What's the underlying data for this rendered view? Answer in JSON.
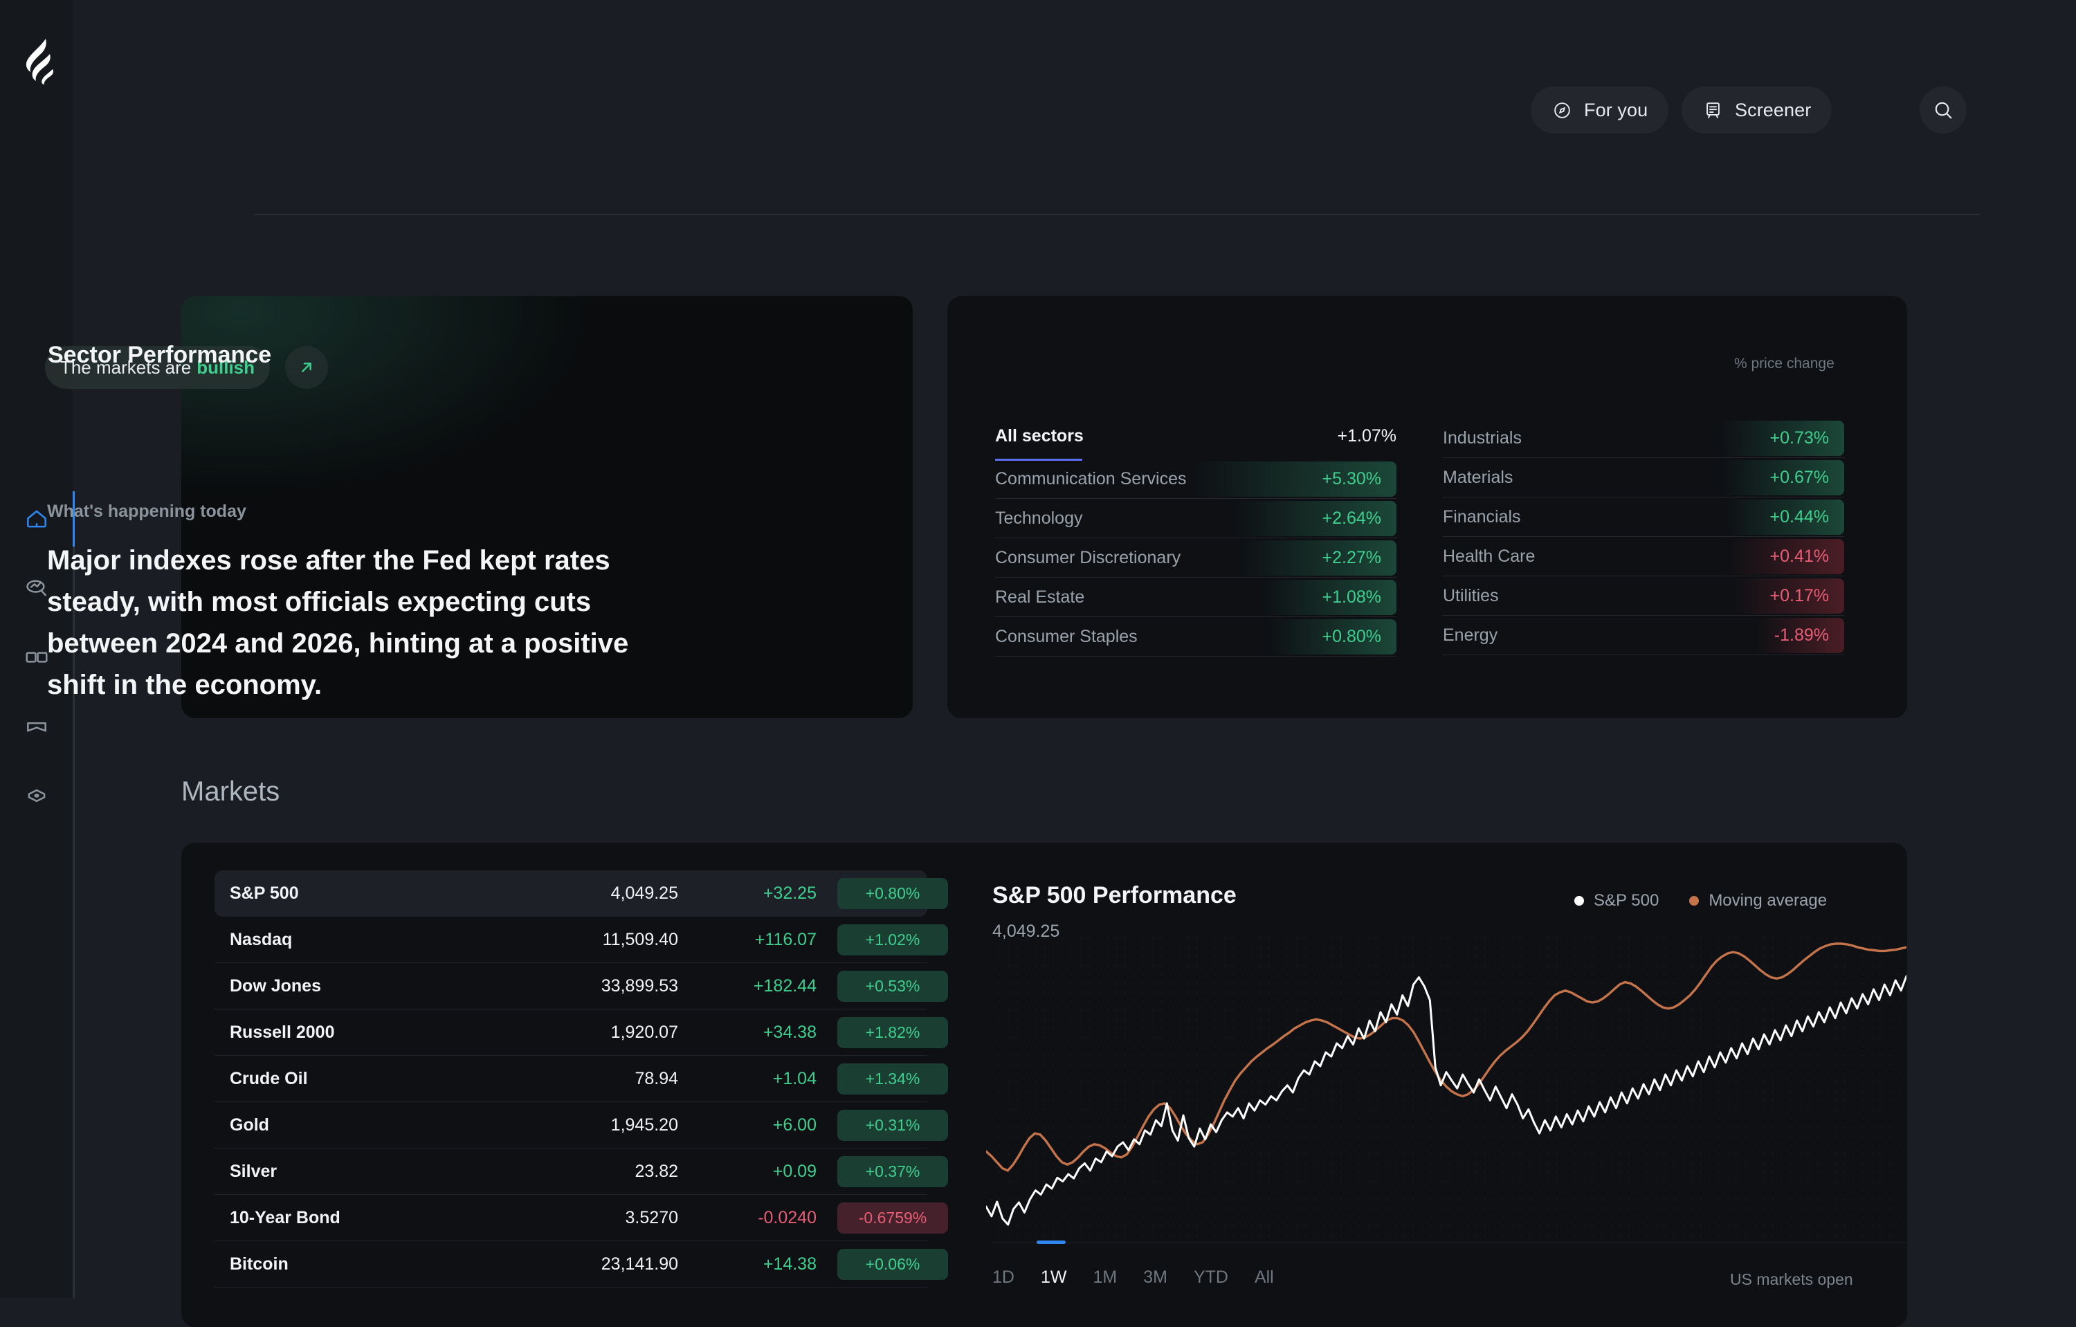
{
  "app": {
    "logo_icon": "flame-logo"
  },
  "sidebar": {
    "items": [
      {
        "icon": "home-icon",
        "name": "home",
        "active": true
      },
      {
        "icon": "discover-chart-search-icon",
        "name": "discover",
        "active": false
      },
      {
        "icon": "book-open-icon",
        "name": "library",
        "active": false
      },
      {
        "icon": "bookmark-icon",
        "name": "saved",
        "active": false
      },
      {
        "icon": "target-eye-icon",
        "name": "watchlist",
        "active": false
      }
    ]
  },
  "header": {
    "for_you_label": "For you",
    "for_you_icon": "compass-icon",
    "screener_label": "Screener",
    "screener_icon": "screener-board-icon",
    "search_icon": "search-icon",
    "save_icon": "bookmark-add-icon"
  },
  "news": {
    "sentiment_prefix": "The markets are",
    "sentiment_word": "bullish",
    "arrow_icon": "arrow-up-right-icon",
    "kicker": "What's happening today",
    "headline": "Major indexes rose after the Fed kept rates steady, with most officials expecting cuts between 2024 and 2026, hinting at a positive shift in the economy."
  },
  "sector": {
    "title": "Sector Performance",
    "subtitle": "% price change",
    "all_label": "All sectors",
    "all_value": "+1.07%",
    "left": [
      {
        "name": "Communication Services",
        "value": "+5.30%",
        "dir": "pos",
        "bar": 295
      },
      {
        "name": "Technology",
        "value": "+2.64%",
        "dir": "pos",
        "bar": 238
      },
      {
        "name": "Consumer Discretionary",
        "value": "+2.27%",
        "dir": "pos",
        "bar": 228
      },
      {
        "name": "Real Estate",
        "value": "+1.08%",
        "dir": "pos",
        "bar": 196
      },
      {
        "name": "Consumer Staples",
        "value": "+0.80%",
        "dir": "pos",
        "bar": 188
      }
    ],
    "right": [
      {
        "name": "Industrials",
        "value": "+0.73%",
        "dir": "pos",
        "bar": 180
      },
      {
        "name": "Materials",
        "value": "+0.67%",
        "dir": "pos",
        "bar": 178
      },
      {
        "name": "Financials",
        "value": "+0.44%",
        "dir": "pos",
        "bar": 172
      },
      {
        "name": "Health Care",
        "value": "+0.41%",
        "dir": "neg",
        "bar": 170
      },
      {
        "name": "Utilities",
        "value": "+0.17%",
        "dir": "neg",
        "bar": 163
      },
      {
        "name": "Energy",
        "value": "-1.89%",
        "dir": "neg",
        "bar": 130
      }
    ]
  },
  "markets": {
    "title": "Markets",
    "rows": [
      {
        "name": "S&P 500",
        "price": "4,049.25",
        "change": "+32.25",
        "pct": "+0.80%",
        "dir": "pos",
        "selected": true
      },
      {
        "name": "Nasdaq",
        "price": "11,509.40",
        "change": "+116.07",
        "pct": "+1.02%",
        "dir": "pos",
        "selected": false
      },
      {
        "name": "Dow Jones",
        "price": "33,899.53",
        "change": "+182.44",
        "pct": "+0.53%",
        "dir": "pos",
        "selected": false
      },
      {
        "name": "Russell 2000",
        "price": "1,920.07",
        "change": "+34.38",
        "pct": "+1.82%",
        "dir": "pos",
        "selected": false
      },
      {
        "name": "Crude Oil",
        "price": "78.94",
        "change": "+1.04",
        "pct": "+1.34%",
        "dir": "pos",
        "selected": false
      },
      {
        "name": "Gold",
        "price": "1,945.20",
        "change": "+6.00",
        "pct": "+0.31%",
        "dir": "pos",
        "selected": false
      },
      {
        "name": "Silver",
        "price": "23.82",
        "change": "+0.09",
        "pct": "+0.37%",
        "dir": "pos",
        "selected": false
      },
      {
        "name": "10-Year Bond",
        "price": "3.5270",
        "change": "-0.0240",
        "pct": "-0.6759%",
        "dir": "neg",
        "selected": false
      },
      {
        "name": "Bitcoin",
        "price": "23,141.90",
        "change": "+14.38",
        "pct": "+0.06%",
        "dir": "pos",
        "selected": false
      }
    ]
  },
  "chart_panel": {
    "title": "S&P 500 Performance",
    "value": "4,049.25",
    "ranges": [
      "1D",
      "1W",
      "1M",
      "3M",
      "YTD",
      "All"
    ],
    "active_range": "1W",
    "market_status": "US markets open"
  },
  "chart_data": {
    "type": "line",
    "title": "S&P 500 Performance",
    "subtitle": "4,049.25",
    "xlabel": "",
    "ylabel": "",
    "grid": "dotted",
    "legend_position": "top-right",
    "colors": {
      "sp500": "#ffffff",
      "moving_average": "#c4734a"
    },
    "series": [
      {
        "name": "S&P 500",
        "color": "#ffffff",
        "values": [
          3948,
          3932,
          3956,
          3928,
          3918,
          3944,
          3955,
          3938,
          3960,
          3975,
          3968,
          3985,
          3978,
          3996,
          3990,
          4002,
          3995,
          4012,
          4020,
          4008,
          4028,
          4022,
          4040,
          4032,
          4048,
          4055,
          4042,
          4060,
          4052,
          4075,
          4068,
          4092,
          4082,
          4120,
          4075,
          4058,
          4100,
          4062,
          4048,
          4078,
          4060,
          4085,
          4072,
          4092,
          4105,
          4098,
          4112,
          4095,
          4120,
          4108,
          4125,
          4118,
          4132,
          4125,
          4140,
          4150,
          4138,
          4162,
          4175,
          4168,
          4190,
          4182,
          4205,
          4198,
          4220,
          4212,
          4232,
          4218,
          4245,
          4228,
          4258,
          4240,
          4272,
          4255,
          4285,
          4268,
          4300,
          4282,
          4318,
          4330,
          4315,
          4292,
          4180,
          4150,
          4172,
          4158,
          4145,
          4168,
          4152,
          4138,
          4160,
          4142,
          4125,
          4148,
          4130,
          4112,
          4135,
          4118,
          4095,
          4110,
          4088,
          4070,
          4092,
          4075,
          4098,
          4080,
          4102,
          4085,
          4108,
          4090,
          4115,
          4098,
          4122,
          4105,
          4130,
          4112,
          4138,
          4120,
          4145,
          4128,
          4152,
          4135,
          4160,
          4142,
          4168,
          4150,
          4175,
          4158,
          4182,
          4165,
          4190,
          4172,
          4198,
          4180,
          4205,
          4188,
          4212,
          4195,
          4220,
          4202,
          4228,
          4210,
          4235,
          4218,
          4242,
          4225,
          4250,
          4232,
          4258,
          4240,
          4265,
          4248,
          4272,
          4255,
          4280,
          4262,
          4288,
          4270,
          4295,
          4278,
          4302,
          4285,
          4310,
          4292,
          4318,
          4300,
          4325,
          4308,
          4332
        ]
      },
      {
        "name": "Moving average",
        "color": "#c4734a",
        "values": [
          4040,
          4032,
          4022,
          4012,
          4008,
          4018,
          4032,
          4048,
          4062,
          4070,
          4068,
          4058,
          4045,
          4032,
          4022,
          4018,
          4022,
          4030,
          4040,
          4048,
          4052,
          4050,
          4045,
          4038,
          4032,
          4030,
          4035,
          4048,
          4065,
          4082,
          4098,
          4110,
          4118,
          4120,
          4112,
          4098,
          4082,
          4068,
          4058,
          4052,
          4055,
          4068,
          4085,
          4105,
          4125,
          4142,
          4158,
          4170,
          4180,
          4190,
          4198,
          4205,
          4212,
          4218,
          4225,
          4232,
          4238,
          4245,
          4250,
          4255,
          4258,
          4260,
          4258,
          4255,
          4250,
          4245,
          4240,
          4235,
          4230,
          4228,
          4230,
          4235,
          4242,
          4250,
          4258,
          4262,
          4262,
          4258,
          4250,
          4238,
          4222,
          4205,
          4188,
          4172,
          4158,
          4148,
          4140,
          4135,
          4132,
          4135,
          4142,
          4152,
          4165,
          4178,
          4190,
          4200,
          4208,
          4215,
          4222,
          4230,
          4240,
          4252,
          4265,
          4278,
          4290,
          4300,
          4305,
          4308,
          4305,
          4300,
          4295,
          4290,
          4288,
          4290,
          4295,
          4302,
          4310,
          4318,
          4322,
          4320,
          4315,
          4308,
          4300,
          4292,
          4285,
          4280,
          4278,
          4280,
          4285,
          4292,
          4300,
          4310,
          4322,
          4335,
          4348,
          4358,
          4365,
          4370,
          4372,
          4370,
          4365,
          4358,
          4350,
          4342,
          4335,
          4330,
          4328,
          4330,
          4335,
          4342,
          4350,
          4358,
          4365,
          4372,
          4378,
          4382,
          4385,
          4386,
          4386,
          4385,
          4383,
          4380,
          4378,
          4376,
          4375,
          4374,
          4374,
          4375,
          4376,
          4378,
          4380
        ]
      }
    ]
  }
}
